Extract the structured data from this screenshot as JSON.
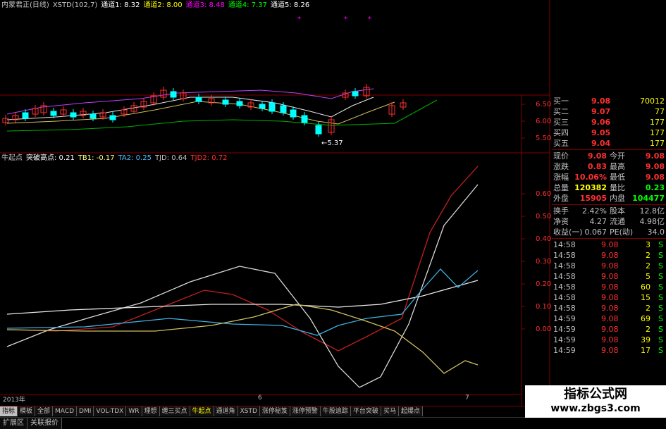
{
  "top_legend": [
    {
      "text": "内蒙君正(日线)",
      "color": "#c8c8c8"
    },
    {
      "text": "XSTD(102,7)",
      "color": "#c8c8c8"
    },
    {
      "text": "通道1: 8.32",
      "color": "#ffffff"
    },
    {
      "text": "通道2: 8.00",
      "color": "#ffff00"
    },
    {
      "text": "通道3: 8.48",
      "color": "#ff00ff"
    },
    {
      "text": "通道4: 7.37",
      "color": "#00ff00"
    },
    {
      "text": "通道5: 8.26",
      "color": "#ffffff"
    }
  ],
  "indicator_legend": [
    {
      "text": "牛起点",
      "color": "#c8c8c8"
    },
    {
      "text": "突破高点: 0.21",
      "color": "#ffffff"
    },
    {
      "text": "TB1: -0.17",
      "color": "#ffff80"
    },
    {
      "text": "TA2: 0.25",
      "color": "#40c0ff"
    },
    {
      "text": "TJD: 0.64",
      "color": "#c0c0c0"
    },
    {
      "text": "TJD2: 0.72",
      "color": "#ff3030"
    }
  ],
  "price_axis": [
    "6.50",
    "6.00",
    "5.50"
  ],
  "indicator_axis": [
    "0.60",
    "0.50",
    "0.40",
    "0.30",
    "0.20",
    "0.10",
    "0.00"
  ],
  "low_label": "5.37",
  "dates": {
    "left": "2013年",
    "mid": "6",
    "right": "7"
  },
  "quote": {
    "order_book": [
      {
        "label": "买一",
        "price": "9.08",
        "vol": "70012"
      },
      {
        "label": "买二",
        "price": "9.07",
        "vol": "77"
      },
      {
        "label": "买三",
        "price": "9.06",
        "vol": "177"
      },
      {
        "label": "买四",
        "price": "9.05",
        "vol": "177"
      },
      {
        "label": "买五",
        "price": "9.04",
        "vol": "177"
      }
    ],
    "stats": [
      {
        "l1": "现价",
        "v1": "9.08",
        "c1": "#ff3030",
        "l2": "今开",
        "v2": "9.08",
        "c2": "#ff3030"
      },
      {
        "l1": "涨跌",
        "v1": "0.83",
        "c1": "#ff3030",
        "l2": "最高",
        "v2": "9.08",
        "c2": "#ff3030"
      },
      {
        "l1": "涨幅",
        "v1": "10.06%",
        "c1": "#ff3030",
        "l2": "最低",
        "v2": "9.08",
        "c2": "#ff3030"
      },
      {
        "l1": "总量",
        "v1": "120382",
        "c1": "#ffff00",
        "l2": "量比",
        "v2": "0.23",
        "c2": "#00ff00"
      },
      {
        "l1": "外盘",
        "v1": "15905",
        "c1": "#ff3030",
        "l2": "内盘",
        "v2": "104477",
        "c2": "#00ff00"
      }
    ],
    "fundamentals": [
      {
        "l1": "换手",
        "v1": "2.42%",
        "l2": "股本",
        "v2": "12.8亿"
      },
      {
        "l1": "净资",
        "v1": "4.27",
        "l2": "流通",
        "v2": "4.98亿"
      },
      {
        "l1": "收益(一)",
        "v1": "0.067",
        "l2": "PE(动)",
        "v2": "34.0"
      }
    ],
    "ticks": [
      {
        "time": "14:58",
        "price": "9.08",
        "vol": "3",
        "side": "S"
      },
      {
        "time": "14:58",
        "price": "9.08",
        "vol": "2",
        "side": "S"
      },
      {
        "time": "14:58",
        "price": "9.08",
        "vol": "2",
        "side": "S"
      },
      {
        "time": "14:58",
        "price": "9.08",
        "vol": "5",
        "side": "S"
      },
      {
        "time": "14:58",
        "price": "9.08",
        "vol": "60",
        "side": "S"
      },
      {
        "time": "14:58",
        "price": "9.08",
        "vol": "15",
        "side": "S"
      },
      {
        "time": "14:58",
        "price": "9.08",
        "vol": "2",
        "side": "S"
      },
      {
        "time": "14:59",
        "price": "9.08",
        "vol": "69",
        "side": "S"
      },
      {
        "time": "14:59",
        "price": "9.08",
        "vol": "2",
        "side": "S"
      },
      {
        "time": "14:59",
        "price": "9.08",
        "vol": "39",
        "side": "S"
      },
      {
        "time": "14:59",
        "price": "9.08",
        "vol": "17",
        "side": "S"
      }
    ]
  },
  "tabs": [
    "指标",
    "模板",
    "全部",
    "MACD",
    "DMI",
    "VOL-TDX",
    "WR",
    "理想",
    "缠三买点",
    "牛起点",
    "通道角",
    "XSTD",
    "涨停秘笈",
    "涨停预警",
    "牛股追踪",
    "平台突破",
    "买马",
    "起爆点"
  ],
  "active_tab": "指标",
  "highlight_tab": "牛起点",
  "bottom_tabs": [
    "扩展区",
    "关联报价"
  ],
  "watermark": {
    "title": "指标公式网",
    "url": "www.zbgs3.com"
  },
  "colors": {
    "up": "#ff3030",
    "down": "#00ffff",
    "grid": "#800000",
    "white_line": "#e8e8e8",
    "yellow_line": "#d0c060",
    "cyan_line": "#40b0e0",
    "red_line": "#c02020",
    "green_line": "#00b000",
    "magenta_line": "#c040ff"
  }
}
